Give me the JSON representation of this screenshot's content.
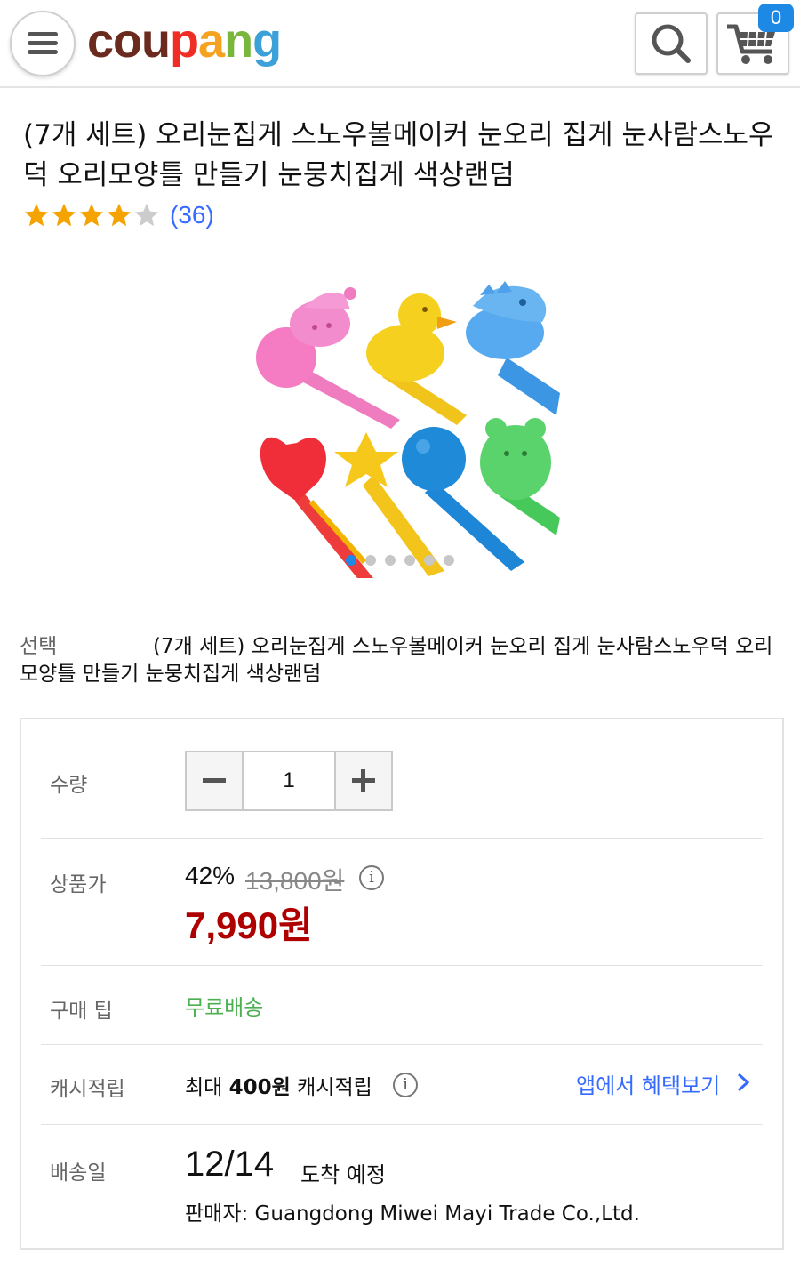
{
  "header": {
    "logo_letters": [
      "c",
      "o",
      "u",
      "p",
      "a",
      "n",
      "g"
    ],
    "logo_colors": [
      "#6b2a1e",
      "#6b2a1e",
      "#6b2a1e",
      "#ef2d24",
      "#f6a221",
      "#79b63c",
      "#3ca0d9"
    ],
    "menu_icon": "hamburger-menu-icon",
    "search_icon": "search-icon",
    "cart_icon": "cart-icon",
    "cart_count": "0"
  },
  "product": {
    "title": "(7개 세트) 오리눈집게 스노우볼메이커 눈오리 집게 눈사람스노우덕 오리모양틀 만들기 눈뭉치집게 색상랜덤",
    "rating": 4,
    "rating_max": 5,
    "review_count": "(36)",
    "image_slide_count": 6,
    "image_active_index": 0
  },
  "option": {
    "label": "선택",
    "value": "(7개 세트) 오리눈집게 스노우볼메이커 눈오리 집게 눈사람스노우덕 오리모양틀 만들기 눈뭉치집게 색상랜덤"
  },
  "quantity": {
    "label": "수량",
    "value": "1",
    "minus_icon": "minus-icon",
    "plus_icon": "plus-icon"
  },
  "price": {
    "label": "상품가",
    "discount": "42%",
    "original": "13,800원",
    "sale": "7,990원",
    "info_icon": "i"
  },
  "tip": {
    "label": "구매 팁",
    "value": "무료배송"
  },
  "cash": {
    "label": "캐시적립",
    "prefix": "최대 ",
    "amount": "400원",
    "suffix": " 캐시적립",
    "info_icon": "i",
    "app_link": "앱에서 혜택보기"
  },
  "delivery": {
    "label": "배송일",
    "date": "12/14",
    "suffix": "도착 예정",
    "seller": "판매자: Guangdong Miwei Mayi Trade Co.,Ltd."
  },
  "colors": {
    "sale_price": "#ae0000",
    "link": "#346aff",
    "free_shipping": "#4caf50",
    "star": "#f5a300",
    "badge": "#1e88e5"
  }
}
